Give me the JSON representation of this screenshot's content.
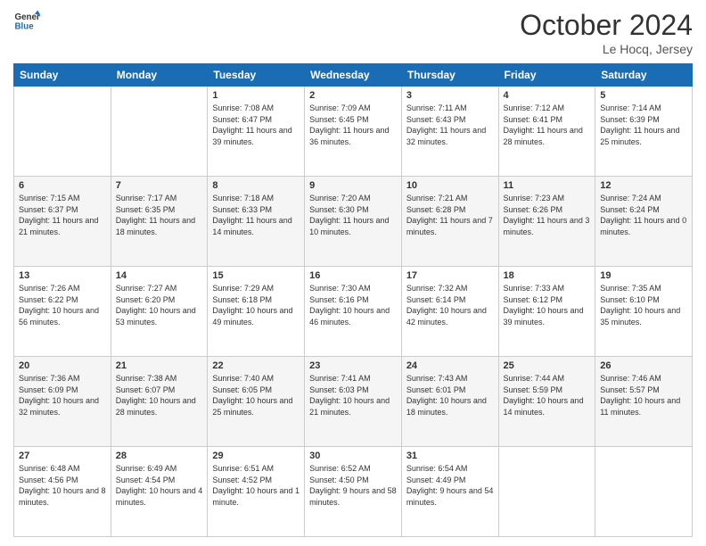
{
  "header": {
    "logo_line1": "General",
    "logo_line2": "Blue",
    "month": "October 2024",
    "location": "Le Hocq, Jersey"
  },
  "days_of_week": [
    "Sunday",
    "Monday",
    "Tuesday",
    "Wednesday",
    "Thursday",
    "Friday",
    "Saturday"
  ],
  "weeks": [
    [
      {
        "day": "",
        "sunrise": "",
        "sunset": "",
        "daylight": ""
      },
      {
        "day": "",
        "sunrise": "",
        "sunset": "",
        "daylight": ""
      },
      {
        "day": "1",
        "sunrise": "Sunrise: 7:08 AM",
        "sunset": "Sunset: 6:47 PM",
        "daylight": "Daylight: 11 hours and 39 minutes."
      },
      {
        "day": "2",
        "sunrise": "Sunrise: 7:09 AM",
        "sunset": "Sunset: 6:45 PM",
        "daylight": "Daylight: 11 hours and 36 minutes."
      },
      {
        "day": "3",
        "sunrise": "Sunrise: 7:11 AM",
        "sunset": "Sunset: 6:43 PM",
        "daylight": "Daylight: 11 hours and 32 minutes."
      },
      {
        "day": "4",
        "sunrise": "Sunrise: 7:12 AM",
        "sunset": "Sunset: 6:41 PM",
        "daylight": "Daylight: 11 hours and 28 minutes."
      },
      {
        "day": "5",
        "sunrise": "Sunrise: 7:14 AM",
        "sunset": "Sunset: 6:39 PM",
        "daylight": "Daylight: 11 hours and 25 minutes."
      }
    ],
    [
      {
        "day": "6",
        "sunrise": "Sunrise: 7:15 AM",
        "sunset": "Sunset: 6:37 PM",
        "daylight": "Daylight: 11 hours and 21 minutes."
      },
      {
        "day": "7",
        "sunrise": "Sunrise: 7:17 AM",
        "sunset": "Sunset: 6:35 PM",
        "daylight": "Daylight: 11 hours and 18 minutes."
      },
      {
        "day": "8",
        "sunrise": "Sunrise: 7:18 AM",
        "sunset": "Sunset: 6:33 PM",
        "daylight": "Daylight: 11 hours and 14 minutes."
      },
      {
        "day": "9",
        "sunrise": "Sunrise: 7:20 AM",
        "sunset": "Sunset: 6:30 PM",
        "daylight": "Daylight: 11 hours and 10 minutes."
      },
      {
        "day": "10",
        "sunrise": "Sunrise: 7:21 AM",
        "sunset": "Sunset: 6:28 PM",
        "daylight": "Daylight: 11 hours and 7 minutes."
      },
      {
        "day": "11",
        "sunrise": "Sunrise: 7:23 AM",
        "sunset": "Sunset: 6:26 PM",
        "daylight": "Daylight: 11 hours and 3 minutes."
      },
      {
        "day": "12",
        "sunrise": "Sunrise: 7:24 AM",
        "sunset": "Sunset: 6:24 PM",
        "daylight": "Daylight: 11 hours and 0 minutes."
      }
    ],
    [
      {
        "day": "13",
        "sunrise": "Sunrise: 7:26 AM",
        "sunset": "Sunset: 6:22 PM",
        "daylight": "Daylight: 10 hours and 56 minutes."
      },
      {
        "day": "14",
        "sunrise": "Sunrise: 7:27 AM",
        "sunset": "Sunset: 6:20 PM",
        "daylight": "Daylight: 10 hours and 53 minutes."
      },
      {
        "day": "15",
        "sunrise": "Sunrise: 7:29 AM",
        "sunset": "Sunset: 6:18 PM",
        "daylight": "Daylight: 10 hours and 49 minutes."
      },
      {
        "day": "16",
        "sunrise": "Sunrise: 7:30 AM",
        "sunset": "Sunset: 6:16 PM",
        "daylight": "Daylight: 10 hours and 46 minutes."
      },
      {
        "day": "17",
        "sunrise": "Sunrise: 7:32 AM",
        "sunset": "Sunset: 6:14 PM",
        "daylight": "Daylight: 10 hours and 42 minutes."
      },
      {
        "day": "18",
        "sunrise": "Sunrise: 7:33 AM",
        "sunset": "Sunset: 6:12 PM",
        "daylight": "Daylight: 10 hours and 39 minutes."
      },
      {
        "day": "19",
        "sunrise": "Sunrise: 7:35 AM",
        "sunset": "Sunset: 6:10 PM",
        "daylight": "Daylight: 10 hours and 35 minutes."
      }
    ],
    [
      {
        "day": "20",
        "sunrise": "Sunrise: 7:36 AM",
        "sunset": "Sunset: 6:09 PM",
        "daylight": "Daylight: 10 hours and 32 minutes."
      },
      {
        "day": "21",
        "sunrise": "Sunrise: 7:38 AM",
        "sunset": "Sunset: 6:07 PM",
        "daylight": "Daylight: 10 hours and 28 minutes."
      },
      {
        "day": "22",
        "sunrise": "Sunrise: 7:40 AM",
        "sunset": "Sunset: 6:05 PM",
        "daylight": "Daylight: 10 hours and 25 minutes."
      },
      {
        "day": "23",
        "sunrise": "Sunrise: 7:41 AM",
        "sunset": "Sunset: 6:03 PM",
        "daylight": "Daylight: 10 hours and 21 minutes."
      },
      {
        "day": "24",
        "sunrise": "Sunrise: 7:43 AM",
        "sunset": "Sunset: 6:01 PM",
        "daylight": "Daylight: 10 hours and 18 minutes."
      },
      {
        "day": "25",
        "sunrise": "Sunrise: 7:44 AM",
        "sunset": "Sunset: 5:59 PM",
        "daylight": "Daylight: 10 hours and 14 minutes."
      },
      {
        "day": "26",
        "sunrise": "Sunrise: 7:46 AM",
        "sunset": "Sunset: 5:57 PM",
        "daylight": "Daylight: 10 hours and 11 minutes."
      }
    ],
    [
      {
        "day": "27",
        "sunrise": "Sunrise: 6:48 AM",
        "sunset": "Sunset: 4:56 PM",
        "daylight": "Daylight: 10 hours and 8 minutes."
      },
      {
        "day": "28",
        "sunrise": "Sunrise: 6:49 AM",
        "sunset": "Sunset: 4:54 PM",
        "daylight": "Daylight: 10 hours and 4 minutes."
      },
      {
        "day": "29",
        "sunrise": "Sunrise: 6:51 AM",
        "sunset": "Sunset: 4:52 PM",
        "daylight": "Daylight: 10 hours and 1 minute."
      },
      {
        "day": "30",
        "sunrise": "Sunrise: 6:52 AM",
        "sunset": "Sunset: 4:50 PM",
        "daylight": "Daylight: 9 hours and 58 minutes."
      },
      {
        "day": "31",
        "sunrise": "Sunrise: 6:54 AM",
        "sunset": "Sunset: 4:49 PM",
        "daylight": "Daylight: 9 hours and 54 minutes."
      },
      {
        "day": "",
        "sunrise": "",
        "sunset": "",
        "daylight": ""
      },
      {
        "day": "",
        "sunrise": "",
        "sunset": "",
        "daylight": ""
      }
    ]
  ]
}
